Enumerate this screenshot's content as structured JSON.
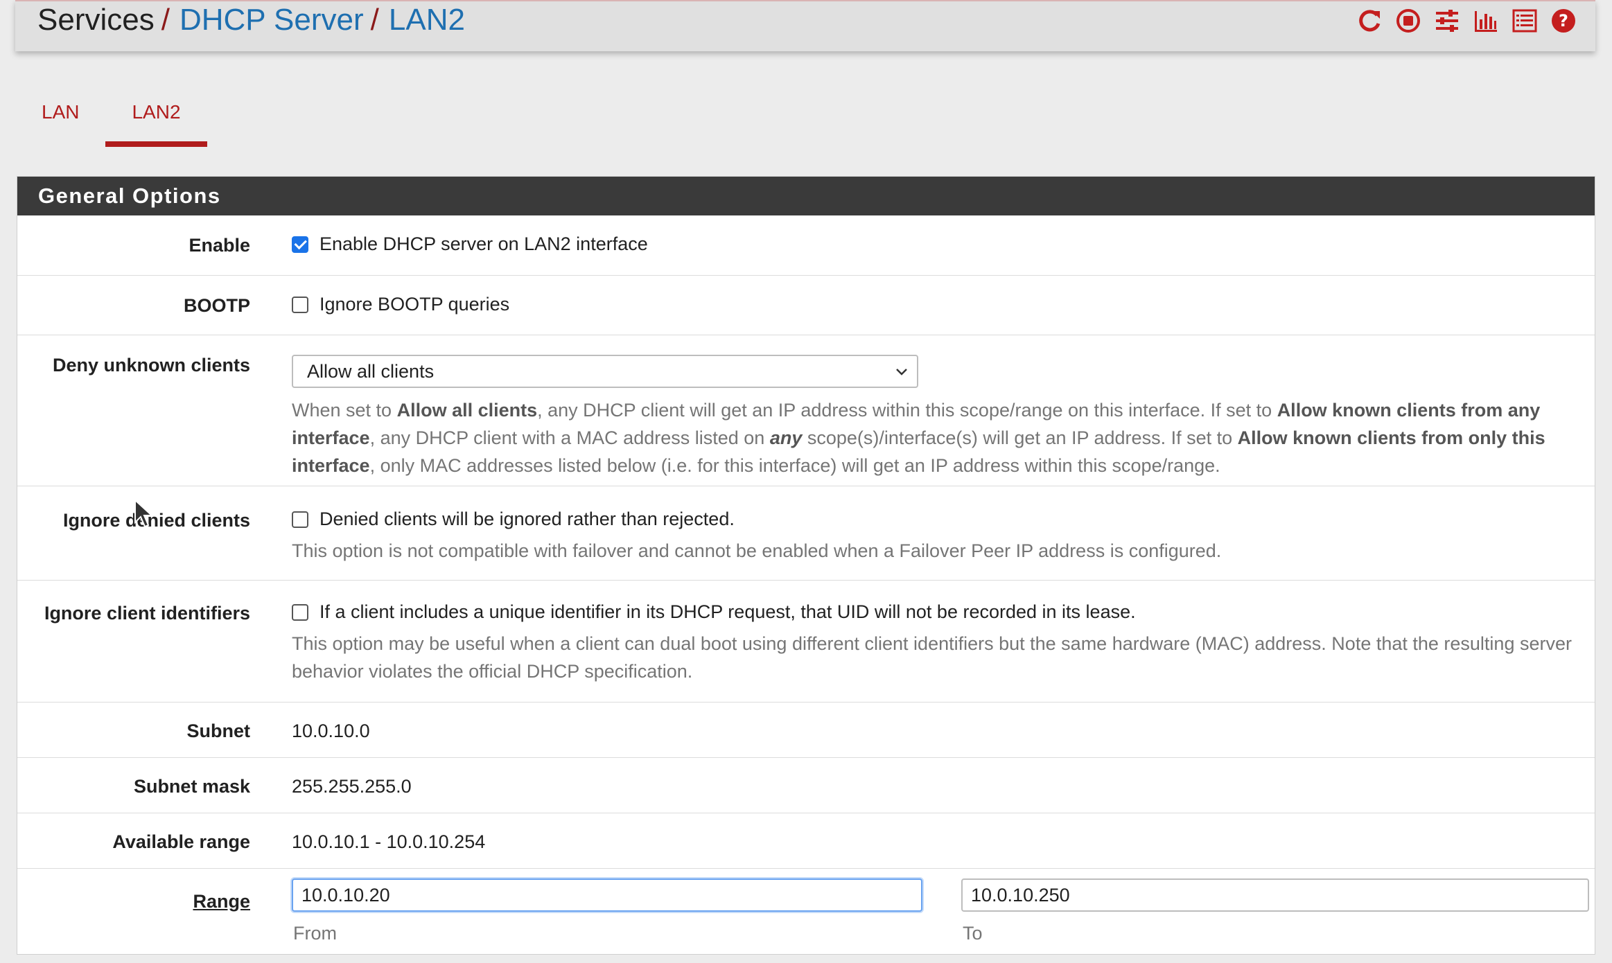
{
  "breadcrumb": {
    "root": "Services",
    "section": "DHCP Server",
    "current": "LAN2",
    "separator": "/"
  },
  "header_icons": [
    "reload-icon",
    "stop-icon",
    "settings-sliders-icon",
    "chart-icon",
    "log-list-icon",
    "help-icon"
  ],
  "accent_color": "#b01c1c",
  "tabs": [
    {
      "label": "LAN",
      "active": false
    },
    {
      "label": "LAN2",
      "active": true
    }
  ],
  "panel": {
    "title": "General Options",
    "enable": {
      "label": "Enable",
      "checkbox_text": "Enable DHCP server on LAN2 interface",
      "checked": true
    },
    "bootp": {
      "label": "BOOTP",
      "checkbox_text": "Ignore BOOTP queries",
      "checked": false
    },
    "deny_unknown": {
      "label": "Deny unknown clients",
      "selected": "Allow all clients",
      "help": {
        "p1": "When set to ",
        "b1": "Allow all clients",
        "p2": ", any DHCP client will get an IP address within this scope/range on this interface. If set to ",
        "b2": "Allow known clients from any interface",
        "p3": ", any DHCP client with a MAC address listed on ",
        "b3": "any",
        "p4": " scope(s)/interface(s) will get an IP address. If set to ",
        "b4": "Allow known clients from only this interface",
        "p5": ", only MAC addresses listed below (i.e. for this interface) will get an IP address within this scope/range."
      }
    },
    "ignore_denied": {
      "label": "Ignore denied clients",
      "checkbox_text": "Denied clients will be ignored rather than rejected.",
      "checked": false,
      "help": "This option is not compatible with failover and cannot be enabled when a Failover Peer IP address is configured."
    },
    "ignore_client_ids": {
      "label": "Ignore client identifiers",
      "checkbox_text": "If a client includes a unique identifier in its DHCP request, that UID will not be recorded in its lease.",
      "checked": false,
      "help": "This option may be useful when a client can dual boot using different client identifiers but the same hardware (MAC) address. Note that the resulting server behavior violates the official DHCP specification."
    },
    "subnet": {
      "label": "Subnet",
      "value": "10.0.10.0"
    },
    "subnet_mask": {
      "label": "Subnet mask",
      "value": "255.255.255.0"
    },
    "available_range": {
      "label": "Available range",
      "value": "10.0.10.1 - 10.0.10.254"
    },
    "range": {
      "label": "Range",
      "from_value": "10.0.10.20",
      "to_value": "10.0.10.250",
      "from_label": "From",
      "to_label": "To"
    }
  }
}
